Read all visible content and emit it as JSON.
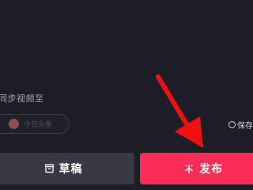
{
  "publish_settings": {
    "sync_label": "同步视频至",
    "sync_account_name": "今日头条",
    "save_option_label": "保存"
  },
  "actions": {
    "draft_label": "草稿",
    "publish_label": "发布"
  },
  "colors": {
    "background": "#1c1d27",
    "draft_button": "#383945",
    "publish_button": "#fb2c55",
    "annotation_arrow": "#f20f10"
  },
  "icons": {
    "draft": "draft-box-icon",
    "publish": "publish-sparkle-icon",
    "annotation": "red-arrow"
  }
}
